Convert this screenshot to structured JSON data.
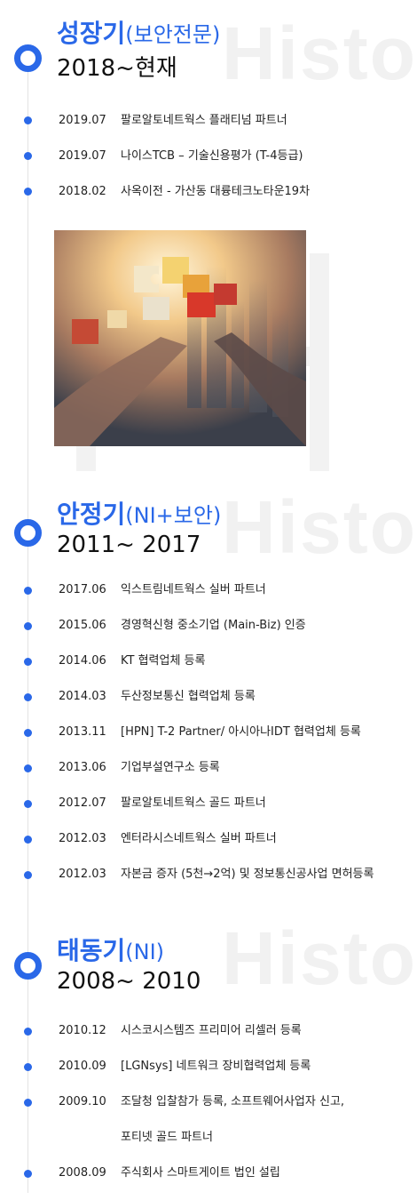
{
  "watermark": "History",
  "sections": [
    {
      "title": "성장기",
      "subtitle": "(보안전문)",
      "years": "2018~현재",
      "items": [
        {
          "date": "2019.07",
          "text": "팔로알토네트웍스 플래티넘 파트너"
        },
        {
          "date": "2019.07",
          "text": "나이스TCB – 기술신용평가 (T-4등급)"
        },
        {
          "date": "2018.02",
          "text": "사옥이전 - 가산동 대륭테크노타운19차"
        }
      ]
    },
    {
      "title": "안정기",
      "subtitle": "(NI+보안)",
      "years": "2011~ 2017",
      "items": [
        {
          "date": "2017.06",
          "text": "익스트림네트웍스 실버 파트너"
        },
        {
          "date": "2015.06",
          "text": "경영혁신형 중소기업 (Main-Biz) 인증"
        },
        {
          "date": "2014.06",
          "text": "KT 협력업체 등록"
        },
        {
          "date": "2014.03",
          "text": "두산정보통신 협력업체 등록"
        },
        {
          "date": "2013.11",
          "text": "[HPN] T-2 Partner/ 아시아나IDT 협력업체 등록"
        },
        {
          "date": "2013.06",
          "text": "기업부설연구소 등록"
        },
        {
          "date": "2012.07",
          "text": "팔로알토네트웍스 골드 파트너"
        },
        {
          "date": "2012.03",
          "text": "엔터라시스네트웍스 실버 파트너"
        },
        {
          "date": "2012.03",
          "text": "자본금 증자 (5천→2억) 및 정보통신공사업 면허등록"
        }
      ]
    },
    {
      "title": "태동기",
      "subtitle": "(NI)",
      "years": "2008~ 2010",
      "items": [
        {
          "date": "2010.12",
          "text": "시스코시스템즈 프리미어 리셀러 등록"
        },
        {
          "date": "2010.09",
          "text": "[LGNsys] 네트워크 장비협력업체 등록"
        },
        {
          "date": "2009.10",
          "text": "조달청 입찰참가 등록, 소프트웨어사업자 신고,"
        },
        {
          "date": "",
          "text": "포티넷 골드 파트너"
        },
        {
          "date": "2008.09",
          "text": "주식회사 스마트게이트 법인 설립"
        }
      ]
    }
  ],
  "colors": {
    "accent": "#2a68e8",
    "line": "#e3e3e3",
    "watermark": "#f1f1f1"
  }
}
